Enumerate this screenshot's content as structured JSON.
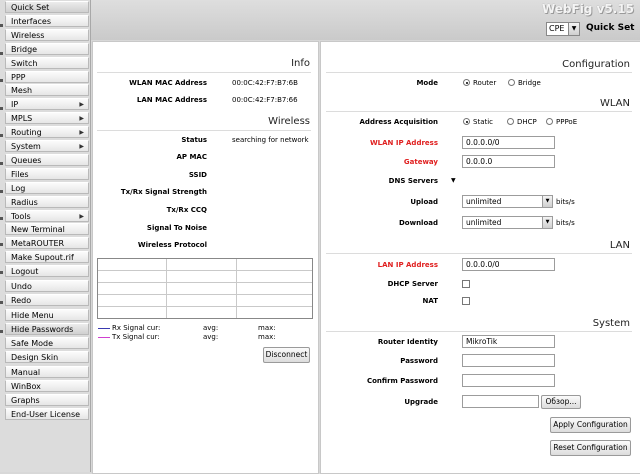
{
  "sidebar": {
    "items": [
      {
        "label": "Quick Set",
        "arrow": false,
        "active": true
      },
      {
        "label": "Interfaces",
        "arrow": false
      },
      {
        "label": "Wireless",
        "arrow": false
      },
      {
        "label": "Bridge",
        "arrow": false
      },
      {
        "label": "Switch",
        "arrow": false
      },
      {
        "label": "PPP",
        "arrow": false
      },
      {
        "label": "Mesh",
        "arrow": false
      },
      {
        "label": "IP",
        "arrow": true
      },
      {
        "label": "MPLS",
        "arrow": true
      },
      {
        "label": "Routing",
        "arrow": true
      },
      {
        "label": "System",
        "arrow": true
      },
      {
        "label": "Queues",
        "arrow": false
      },
      {
        "label": "Files",
        "arrow": false
      },
      {
        "label": "Log",
        "arrow": false
      },
      {
        "label": "Radius",
        "arrow": false
      },
      {
        "label": "Tools",
        "arrow": true
      },
      {
        "label": "New Terminal",
        "arrow": false
      },
      {
        "label": "MetaROUTER",
        "arrow": false
      },
      {
        "label": "Make Supout.rif",
        "arrow": false
      },
      {
        "label": "Logout",
        "arrow": false
      },
      {
        "label": "Undo",
        "arrow": false
      },
      {
        "label": "Redo",
        "arrow": false
      },
      {
        "label": "Hide Menu",
        "arrow": false
      },
      {
        "label": "Hide Passwords",
        "arrow": false,
        "active": true
      },
      {
        "label": "Safe Mode",
        "arrow": false
      },
      {
        "label": "Design Skin",
        "arrow": false
      },
      {
        "label": "Manual",
        "arrow": false
      },
      {
        "label": "WinBox",
        "arrow": false
      },
      {
        "label": "Graphs",
        "arrow": false
      },
      {
        "label": "End-User License",
        "arrow": false
      }
    ],
    "arrow_glyph": "▶"
  },
  "header": {
    "brand": "WebFig v5.15",
    "mode_value": "CPE",
    "dropdown_glyph": "▼",
    "page_title": "Quick Set"
  },
  "info": {
    "title": "Info",
    "wlan_mac_label": "WLAN MAC Address",
    "wlan_mac": "00:0C:42:F7:B7:6B",
    "lan_mac_label": "LAN MAC Address",
    "lan_mac": "00:0C:42:F7:B7:66"
  },
  "wireless": {
    "title": "Wireless",
    "status_label": "Status",
    "status": "searching for network",
    "ap_mac_label": "AP MAC",
    "ssid_label": "SSID",
    "signal_strength_label": "Tx/Rx Signal Strength",
    "ccq_label": "Tx/Rx CCQ",
    "signal_noise_label": "Signal To Noise",
    "protocol_label": "Wireless Protocol",
    "rx_legend": "Rx Signal  cur:",
    "tx_legend": "Tx Signal  cur:",
    "avg_label": "avg:",
    "max_label": "max:",
    "rx_color": "#3a3ab0",
    "tx_color": "#d040d0",
    "disconnect_label": "Disconnect"
  },
  "configuration": {
    "title": "Configuration",
    "mode_label": "Mode",
    "mode_router": "Router",
    "mode_bridge": "Bridge",
    "mode_selected": "Router"
  },
  "wlan": {
    "title": "WLAN",
    "acq_label": "Address Acquisition",
    "acq_static": "Static",
    "acq_dhcp": "DHCP",
    "acq_pppoe": "PPPoE",
    "acq_selected": "Static",
    "ip_label": "WLAN IP Address",
    "ip_value": "0.0.0.0/0",
    "gateway_label": "Gateway",
    "gateway_value": "0.0.0.0",
    "dns_label": "DNS Servers",
    "dns_glyph": "▼",
    "upload_label": "Upload",
    "upload_value": "unlimited",
    "download_label": "Download",
    "download_value": "unlimited",
    "units": "bits/s"
  },
  "lan": {
    "title": "LAN",
    "ip_label": "LAN IP Address",
    "ip_value": "0.0.0.0/0",
    "dhcp_label": "DHCP Server",
    "nat_label": "NAT"
  },
  "system": {
    "title": "System",
    "identity_label": "Router Identity",
    "identity_value": "MikroTik",
    "password_label": "Password",
    "confirm_label": "Confirm Password",
    "upgrade_label": "Upgrade",
    "browse_label": "Обзор...",
    "apply_label": "Apply Configuration",
    "reset_label": "Reset Configuration"
  }
}
